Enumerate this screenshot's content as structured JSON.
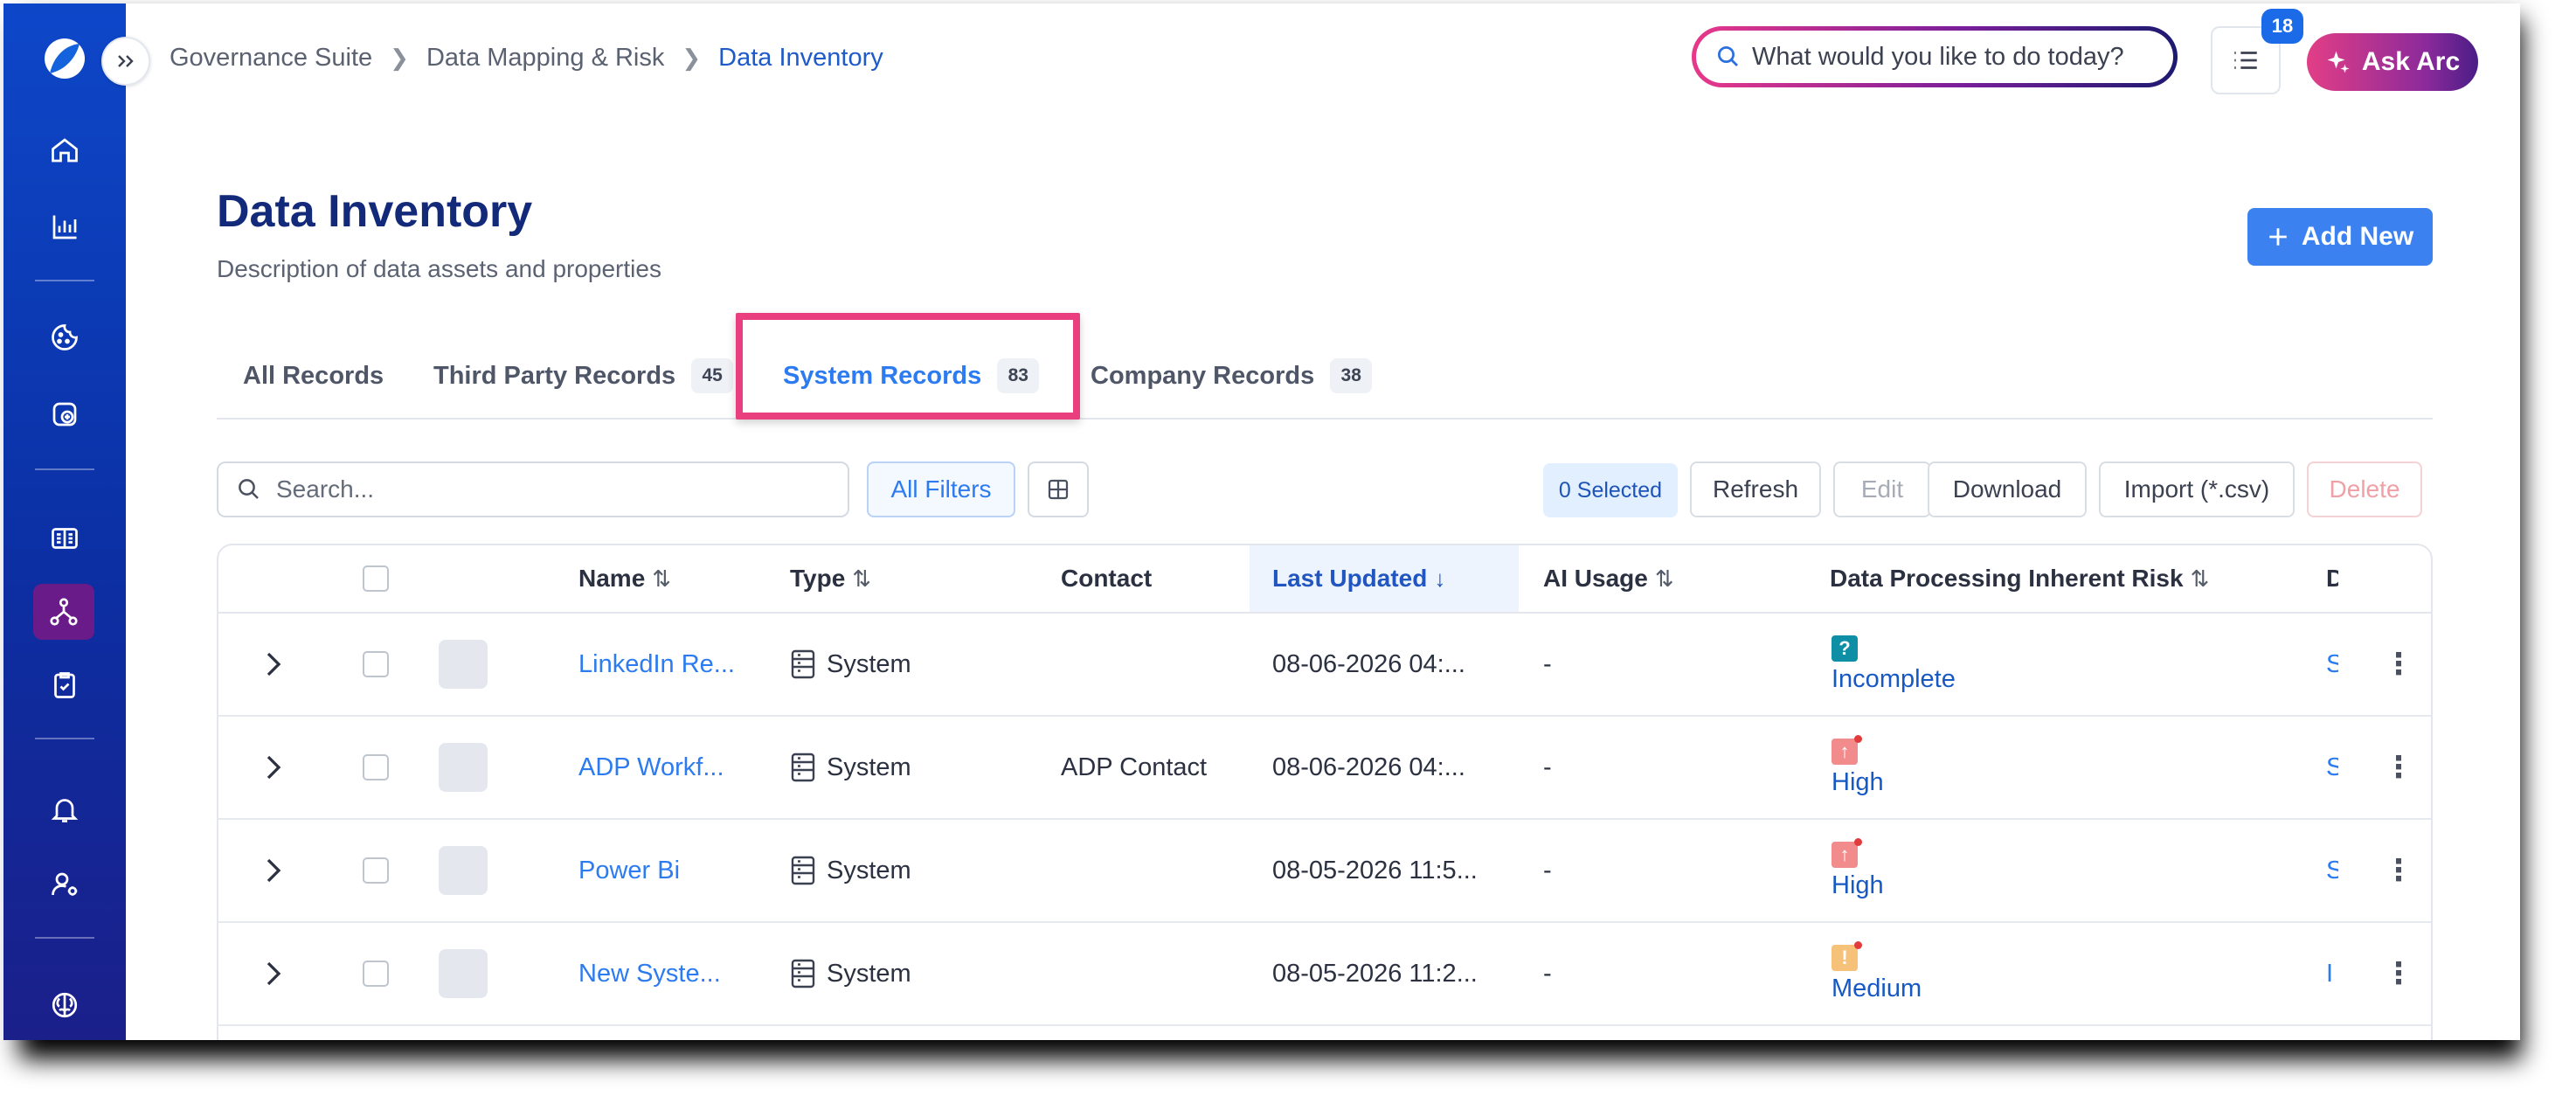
{
  "breadcrumb": [
    "Governance Suite",
    "Data Mapping & Risk",
    "Data Inventory"
  ],
  "header": {
    "ai_placeholder": "What would you like to do today?",
    "notifications_count": "18",
    "ask_label": "Ask Arc"
  },
  "page": {
    "title": "Data Inventory",
    "subtitle": "Description of data assets and properties",
    "add_label": "Add New"
  },
  "tabs": [
    {
      "label": "All Records",
      "count": ""
    },
    {
      "label": "Third Party Records",
      "count": "45"
    },
    {
      "label": "System Records",
      "count": "83"
    },
    {
      "label": "Company Records",
      "count": "38"
    }
  ],
  "toolbar": {
    "search_placeholder": "Search...",
    "filters_label": "All Filters",
    "selected_label": "0 Selected",
    "refresh_label": "Refresh",
    "edit_label": "Edit",
    "download_label": "Download",
    "import_label": "Import (*.csv)",
    "delete_label": "Delete"
  },
  "table": {
    "columns": [
      "Name",
      "Type",
      "Contact",
      "Last Updated",
      "AI Usage",
      "Data Processing Inherent Risk",
      "D"
    ],
    "rows": [
      {
        "name": "LinkedIn Re...",
        "type": "System",
        "contact": "",
        "updated": "08-06-2026 04:...",
        "ai": "-",
        "risk": "Incomplete",
        "risk_symbol": "?",
        "extra": "S"
      },
      {
        "name": "ADP Workf...",
        "type": "System",
        "contact": "ADP Contact",
        "updated": "08-06-2026 04:...",
        "ai": "-",
        "risk": "High",
        "risk_symbol": "↑",
        "extra": "S"
      },
      {
        "name": "Power Bi",
        "type": "System",
        "contact": "",
        "updated": "08-05-2026 11:5...",
        "ai": "-",
        "risk": "High",
        "risk_symbol": "↑",
        "extra": "S"
      },
      {
        "name": "New Syste...",
        "type": "System",
        "contact": "",
        "updated": "08-05-2026 11:2...",
        "ai": "-",
        "risk": "Medium",
        "risk_symbol": "!",
        "extra": "I"
      }
    ]
  },
  "colors": {
    "accent": "#2c7bf0",
    "highlight": "#ea3f7e",
    "risk_incomplete": "#0e8fa6",
    "risk_high": "#f28b8b",
    "risk_medium": "#f6c27a"
  }
}
